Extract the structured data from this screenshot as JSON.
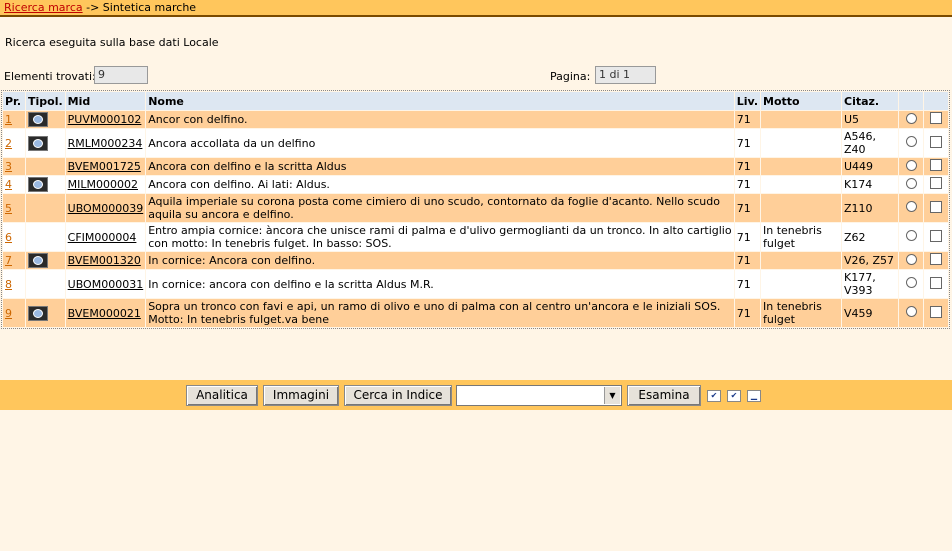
{
  "breadcrumb": {
    "link": "Ricerca marca",
    "separator": "->",
    "current": "Sintetica marche"
  },
  "search_info": "Ricerca eseguita sulla base dati Locale",
  "meta": {
    "found_label": "Elementi trovati:",
    "found_value": "9",
    "page_label": "Pagina:",
    "page_value": "1 di 1"
  },
  "table": {
    "headers": [
      "Pr.",
      "Tipol.",
      "Mid",
      "Nome",
      "Liv.",
      "Motto",
      "Citaz."
    ],
    "rows": [
      {
        "pr": "1",
        "image": true,
        "mid": "PUVM000102",
        "nome": "Ancor con delfino.",
        "liv": "71",
        "motto": "",
        "citaz": "U5"
      },
      {
        "pr": "2",
        "image": true,
        "mid": "RMLM000234",
        "nome": "Ancora accollata da un delfino",
        "liv": "71",
        "motto": "",
        "citaz": "A546, Z40"
      },
      {
        "pr": "3",
        "image": false,
        "mid": "BVEM001725",
        "nome": "Ancora con delfino e la scritta Aldus",
        "liv": "71",
        "motto": "",
        "citaz": "U449"
      },
      {
        "pr": "4",
        "image": true,
        "mid": "MILM000002",
        "nome": "Ancora con delfino. Ai lati: Aldus.",
        "liv": "71",
        "motto": "",
        "citaz": "K174"
      },
      {
        "pr": "5",
        "image": false,
        "mid": "UBOM000039",
        "nome": "Aquila imperiale su corona posta come cimiero di uno scudo, contornato da foglie d'acanto. Nello scudo aquila su ancora e delfino.",
        "liv": "71",
        "motto": "",
        "citaz": "Z110"
      },
      {
        "pr": "6",
        "image": false,
        "mid": "CFIM000004",
        "nome": "Entro ampia cornice: àncora che unisce rami di palma e d'ulivo germoglianti da un tronco. In alto cartiglio con motto: In tenebris fulget. In basso: SOS.",
        "liv": "71",
        "motto": "In tenebris fulget",
        "citaz": "Z62"
      },
      {
        "pr": "7",
        "image": true,
        "mid": "BVEM001320",
        "nome": "In cornice: Ancora con delfino.",
        "liv": "71",
        "motto": "",
        "citaz": "V26, Z57"
      },
      {
        "pr": "8",
        "image": false,
        "mid": "UBOM000031",
        "nome": "In cornice: ancora con delfino e la scritta Aldus M.R.",
        "liv": "71",
        "motto": "",
        "citaz": "K177, V393"
      },
      {
        "pr": "9",
        "image": true,
        "mid": "BVEM000021",
        "nome": "Sopra un tronco con favi e api, un ramo di olivo e uno di palma con al centro un'ancora e le iniziali SOS. Motto: In tenebris fulget.va bene",
        "liv": "71",
        "motto": "In tenebris fulget",
        "citaz": "V459"
      }
    ]
  },
  "toolbar": {
    "analitica": "Analitica",
    "immagini": "Immagini",
    "cerca_indice": "Cerca in Indice",
    "select_value": "",
    "esamina": "Esamina",
    "icons": [
      "select-all-icon",
      "deselect-all-icon",
      "reset-icon"
    ]
  },
  "colors": {
    "accent": "#FFC65C",
    "row_alt": "#FFCF99",
    "header": "#DDE7F2",
    "background": "#FFF5E6"
  }
}
